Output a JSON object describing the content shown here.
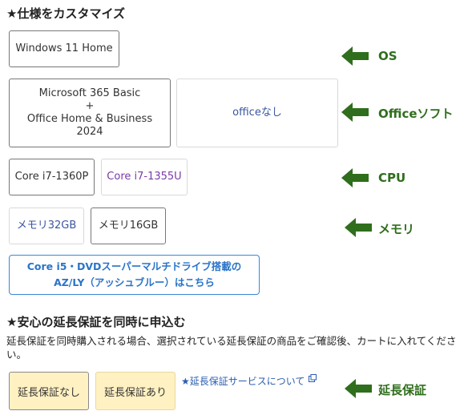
{
  "customize": {
    "heading": "★仕様をカスタマイズ",
    "os": {
      "option1": "Windows 11 Home"
    },
    "office": {
      "option1_line1": "Microsoft 365 Basic",
      "option1_line2": "+",
      "option1_line3": "Office Home & Business",
      "option1_line4": "2024",
      "option2": "officeなし"
    },
    "cpu": {
      "option1": "Core i7-1360P",
      "option2": "Core i7-1355U"
    },
    "memory": {
      "option1": "メモリ32GB",
      "option2": "メモリ16GB"
    },
    "link_button": {
      "line1": "Core i5・DVDスーパーマルチドライブ搭載の",
      "line2": "AZ/LY（アッシュブルー）はこちら"
    }
  },
  "warranty": {
    "heading": "★安心の延長保証を同時に申込む",
    "note": "延長保証を同時購入される場合、選択されている延長保証の商品をご確認後、カートに入れてください。",
    "option_none": "延長保証なし",
    "option_yes": "延長保証あり",
    "service_link": "★延長保証サービスについて"
  },
  "annotations": {
    "os": "OS",
    "office": "Officeソフト",
    "cpu": "CPU",
    "memory": "メモリ",
    "warranty": "延長保証",
    "arrow_color": "#2f6e1d"
  },
  "colors": {
    "link_blue": "#2a74c9",
    "option_blue": "#3a56a0",
    "option_purple": "#7a3aa8",
    "warranty_bg": "#fff1c2"
  },
  "icons": {
    "arrow": "left-arrow-icon",
    "external": "external-link-icon"
  }
}
